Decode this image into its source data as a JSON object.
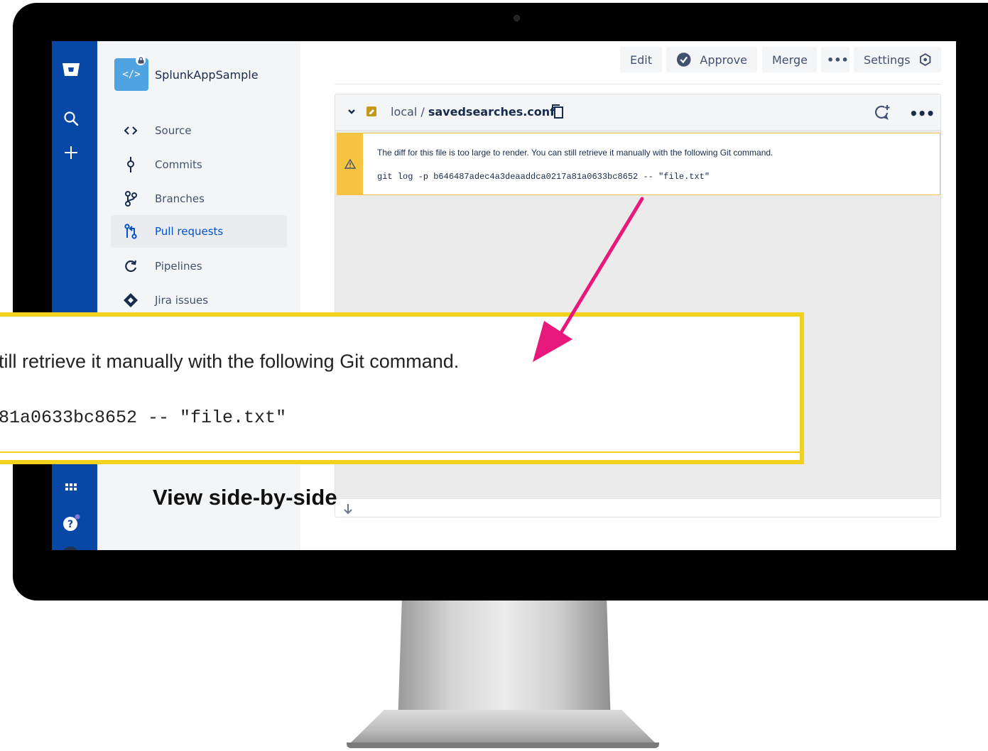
{
  "repo": {
    "name": "SplunkAppSample",
    "avatar_glyph": "</>"
  },
  "sidebar": {
    "items": [
      {
        "label": "Source",
        "icon": "code-icon"
      },
      {
        "label": "Commits",
        "icon": "commit-icon"
      },
      {
        "label": "Branches",
        "icon": "branch-icon"
      },
      {
        "label": "Pull requests",
        "icon": "pull-request-icon",
        "active": true
      },
      {
        "label": "Pipelines",
        "icon": "pipelines-icon"
      },
      {
        "label": "Jira issues",
        "icon": "jira-icon"
      }
    ]
  },
  "toolbar": {
    "edit": "Edit",
    "approve": "Approve",
    "merge": "Merge",
    "more": "•••",
    "settings": "Settings"
  },
  "file": {
    "folder": "local",
    "separator": "/",
    "filename": "savedsearches.conf",
    "more": "•••"
  },
  "warning": {
    "message": "The diff for this file is too large to render. You can still retrieve it manually with the following Git command.",
    "command": "git log -p b646487adec4a3deaaddca0217a81a0633bc8652 -- \"file.txt\""
  },
  "zoom": {
    "message_fragment": "till retrieve it manually with the following Git command.",
    "command_fragment": "81a0633bc8652 -- \"file.txt\""
  },
  "caption": "View side-by-side",
  "colors": {
    "nav_blue": "#0747a6",
    "warning_yellow": "#f6c342",
    "callout_yellow": "#f2d21c",
    "arrow_magenta": "#e8197d"
  }
}
